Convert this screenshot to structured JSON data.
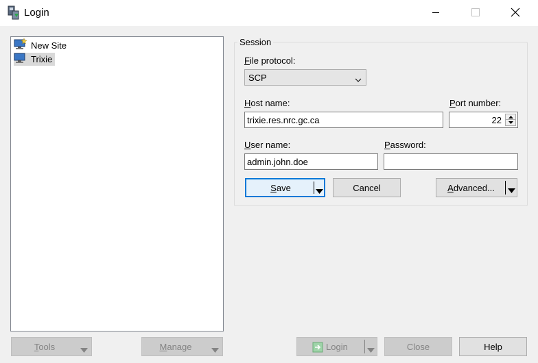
{
  "window": {
    "title": "Login",
    "app_icon": "winscp-icon"
  },
  "title_controls": {
    "minimize_icon": "minimize-icon",
    "maximize_icon": "maximize-icon",
    "close_icon": "close-icon"
  },
  "sites": [
    {
      "label": "New Site",
      "icon": "new-site-monitor-icon",
      "selected": false
    },
    {
      "label": "Trixie",
      "icon": "site-monitor-icon",
      "selected": true
    }
  ],
  "session": {
    "group_label": "Session",
    "file_protocol_label": "File protocol:",
    "file_protocol_value": "SCP",
    "host_name_label": "Host name:",
    "host_name_value": "trixie.res.nrc.gc.ca",
    "port_number_label": "Port number:",
    "port_number_value": "22",
    "user_name_label": "User name:",
    "user_name_value": "admin.john.doe",
    "password_label": "Password:",
    "password_value": "",
    "save_label": "Save",
    "cancel_label": "Cancel",
    "advanced_label": "Advanced..."
  },
  "bottom": {
    "tools_label": "Tools",
    "manage_label": "Manage",
    "login_label": "Login",
    "close_label": "Close",
    "help_label": "Help"
  }
}
